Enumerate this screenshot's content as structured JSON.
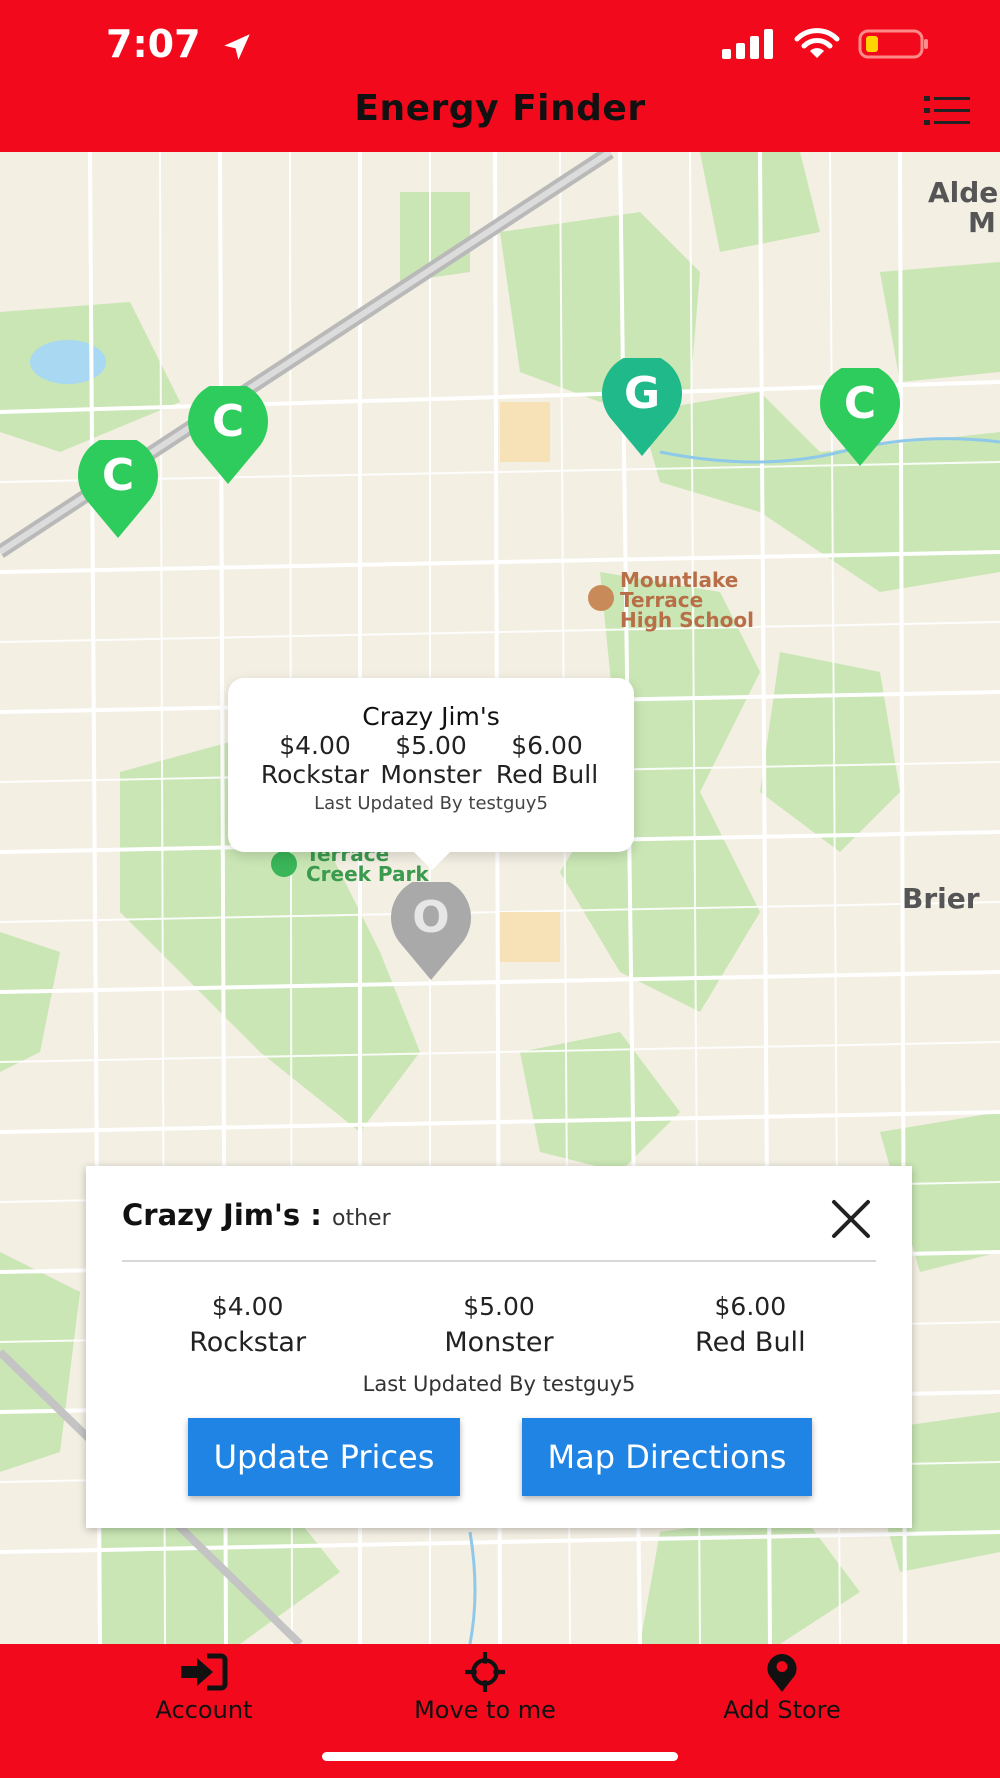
{
  "status_bar": {
    "time": "7:07"
  },
  "header": {
    "title": "Energy Finder"
  },
  "map": {
    "labels": {
      "school": [
        "Mountlake",
        "Terrace",
        "High School"
      ],
      "park": [
        "Terrace",
        "Creek Park"
      ],
      "brier": "Brier",
      "alder": [
        "Alde",
        "M"
      ]
    },
    "pins": [
      {
        "letter": "C",
        "color": "#2ecc5c"
      },
      {
        "letter": "C",
        "color": "#2ecc5c"
      },
      {
        "letter": "G",
        "color": "#1fb98a"
      },
      {
        "letter": "C",
        "color": "#2ecc5c"
      },
      {
        "letter": "O",
        "color": "#a9a9a9"
      }
    ]
  },
  "callout": {
    "store_name": "Crazy Jim's",
    "prices": [
      "$4.00",
      "$5.00",
      "$6.00"
    ],
    "drinks": [
      "Rockstar",
      "Monster",
      "Red Bull"
    ],
    "updated": "Last Updated By testguy5"
  },
  "card": {
    "store_name": "Crazy Jim's :",
    "store_type": "other",
    "drinks": [
      {
        "price": "$4.00",
        "name": "Rockstar"
      },
      {
        "price": "$5.00",
        "name": "Monster"
      },
      {
        "price": "$6.00",
        "name": "Red Bull"
      }
    ],
    "updated": "Last Updated By testguy5",
    "update_button": "Update Prices",
    "directions_button": "Map Directions"
  },
  "bottom_nav": {
    "account": "Account",
    "move_to_me": "Move to me",
    "add_store": "Add Store"
  },
  "colors": {
    "brand_red": "#f20a1c",
    "button_blue": "#1f84e3"
  }
}
